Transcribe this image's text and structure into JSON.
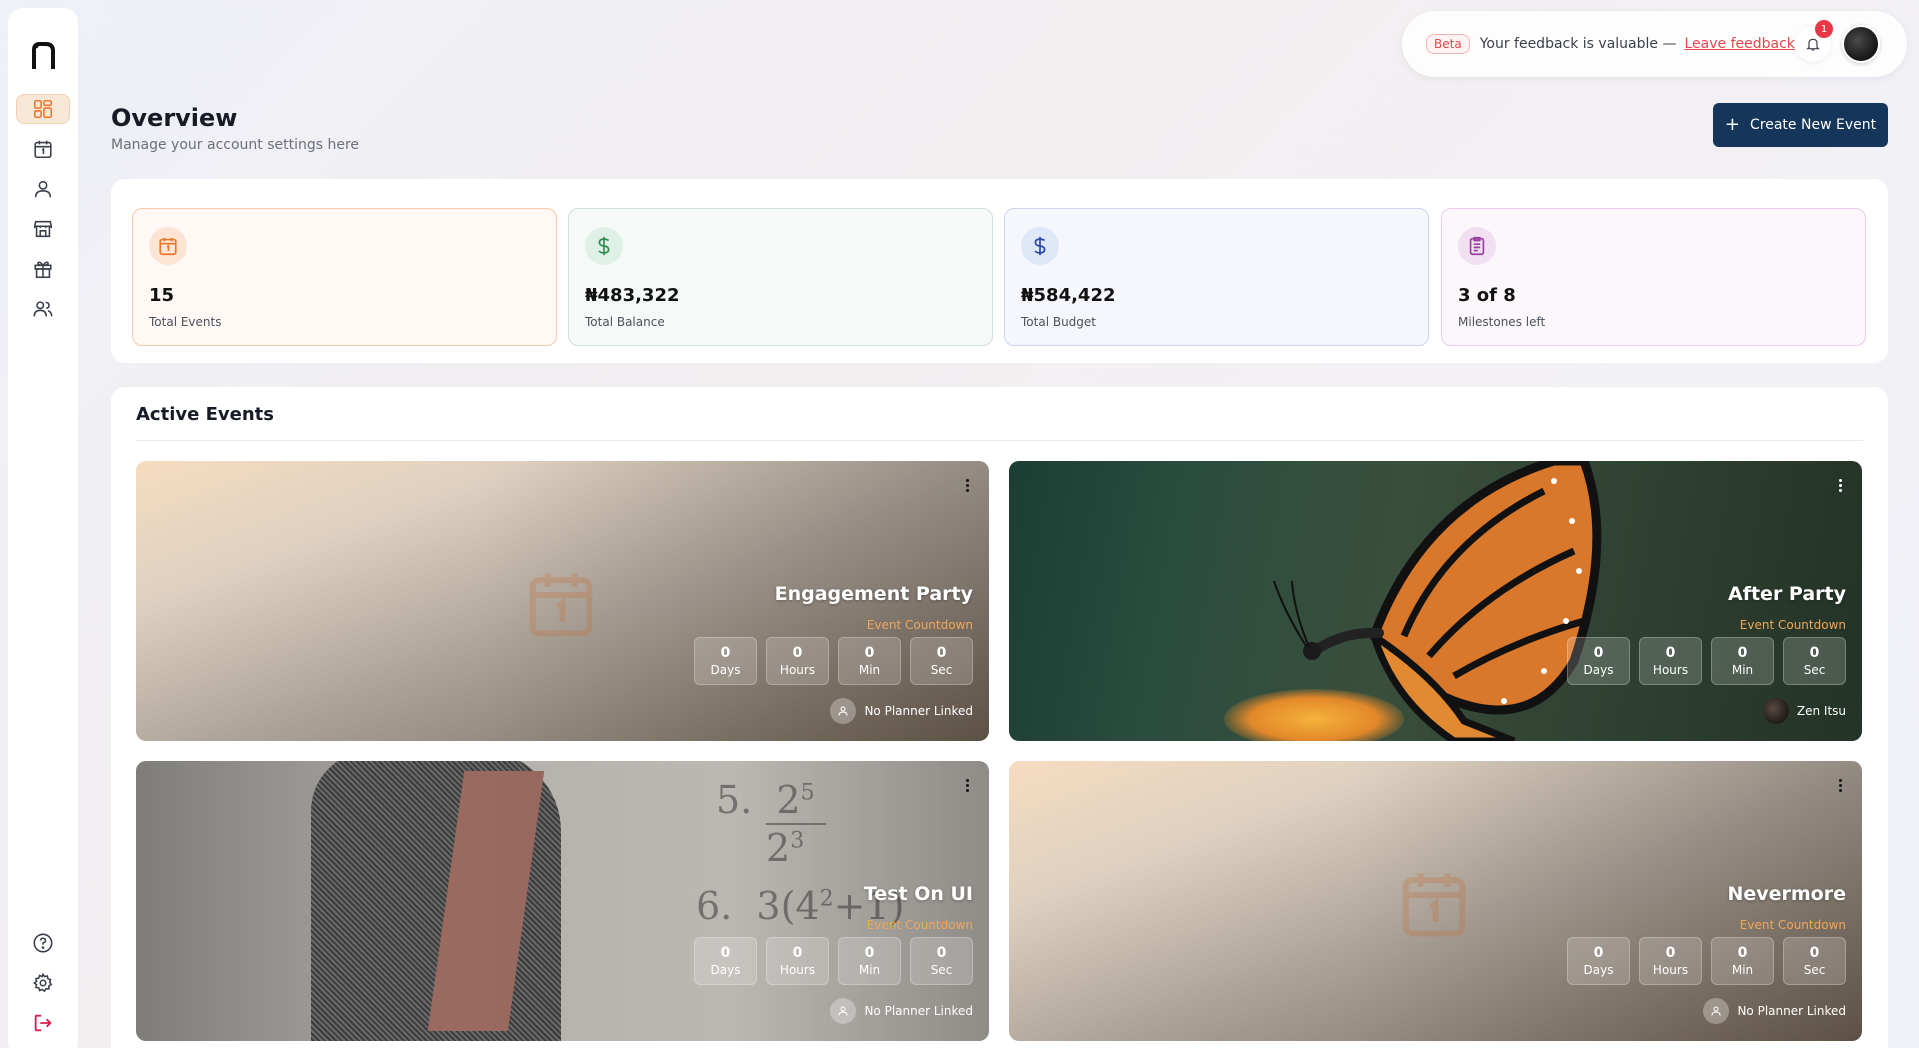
{
  "app": {
    "logo_letter": "n"
  },
  "sidebar": {
    "items": [
      {
        "name": "dashboard",
        "active": true
      },
      {
        "name": "events"
      },
      {
        "name": "profile"
      },
      {
        "name": "vendors"
      },
      {
        "name": "gifts"
      },
      {
        "name": "guests"
      }
    ],
    "bottom": [
      "help",
      "settings",
      "logout"
    ]
  },
  "feedback": {
    "badge": "Beta",
    "text": "Your feedback is valuable —",
    "link": "Leave feedback"
  },
  "notifications": {
    "count": "1"
  },
  "header": {
    "title": "Overview",
    "subtitle": "Manage your account settings here",
    "create_button": "Create New Event"
  },
  "stats": [
    {
      "value": "15",
      "label": "Total Events",
      "icon": "calendar-icon",
      "color": "#e9782e"
    },
    {
      "value": "₦483,322",
      "label": "Total Balance",
      "icon": "dollar-icon",
      "color": "#2f8a4f"
    },
    {
      "value": "₦584,422",
      "label": "Total Budget",
      "icon": "dollar-icon",
      "color": "#2446a8"
    },
    {
      "value": "3 of 8",
      "label": "Milestones left",
      "icon": "clipboard-icon",
      "color": "#9a3ea0"
    }
  ],
  "active_events": {
    "title": "Active Events",
    "countdown_label": "Event Countdown",
    "units": [
      "Days",
      "Hours",
      "Min",
      "Sec"
    ],
    "events": [
      {
        "name": "Engagement Party",
        "countdown": [
          "0",
          "0",
          "0",
          "0"
        ],
        "planner": "No Planner Linked"
      },
      {
        "name": "After Party",
        "countdown": [
          "0",
          "0",
          "0",
          "0"
        ],
        "planner": "Zen Itsu"
      },
      {
        "name": "Test On UI",
        "countdown": [
          "0",
          "0",
          "0",
          "0"
        ],
        "planner": "No Planner Linked"
      },
      {
        "name": "Nevermore",
        "countdown": [
          "0",
          "0",
          "0",
          "0"
        ],
        "planner": "No Planner Linked"
      }
    ]
  },
  "colors": {
    "accent": "#15355a",
    "orange": "#f2a65a",
    "danger": "#e63946"
  }
}
